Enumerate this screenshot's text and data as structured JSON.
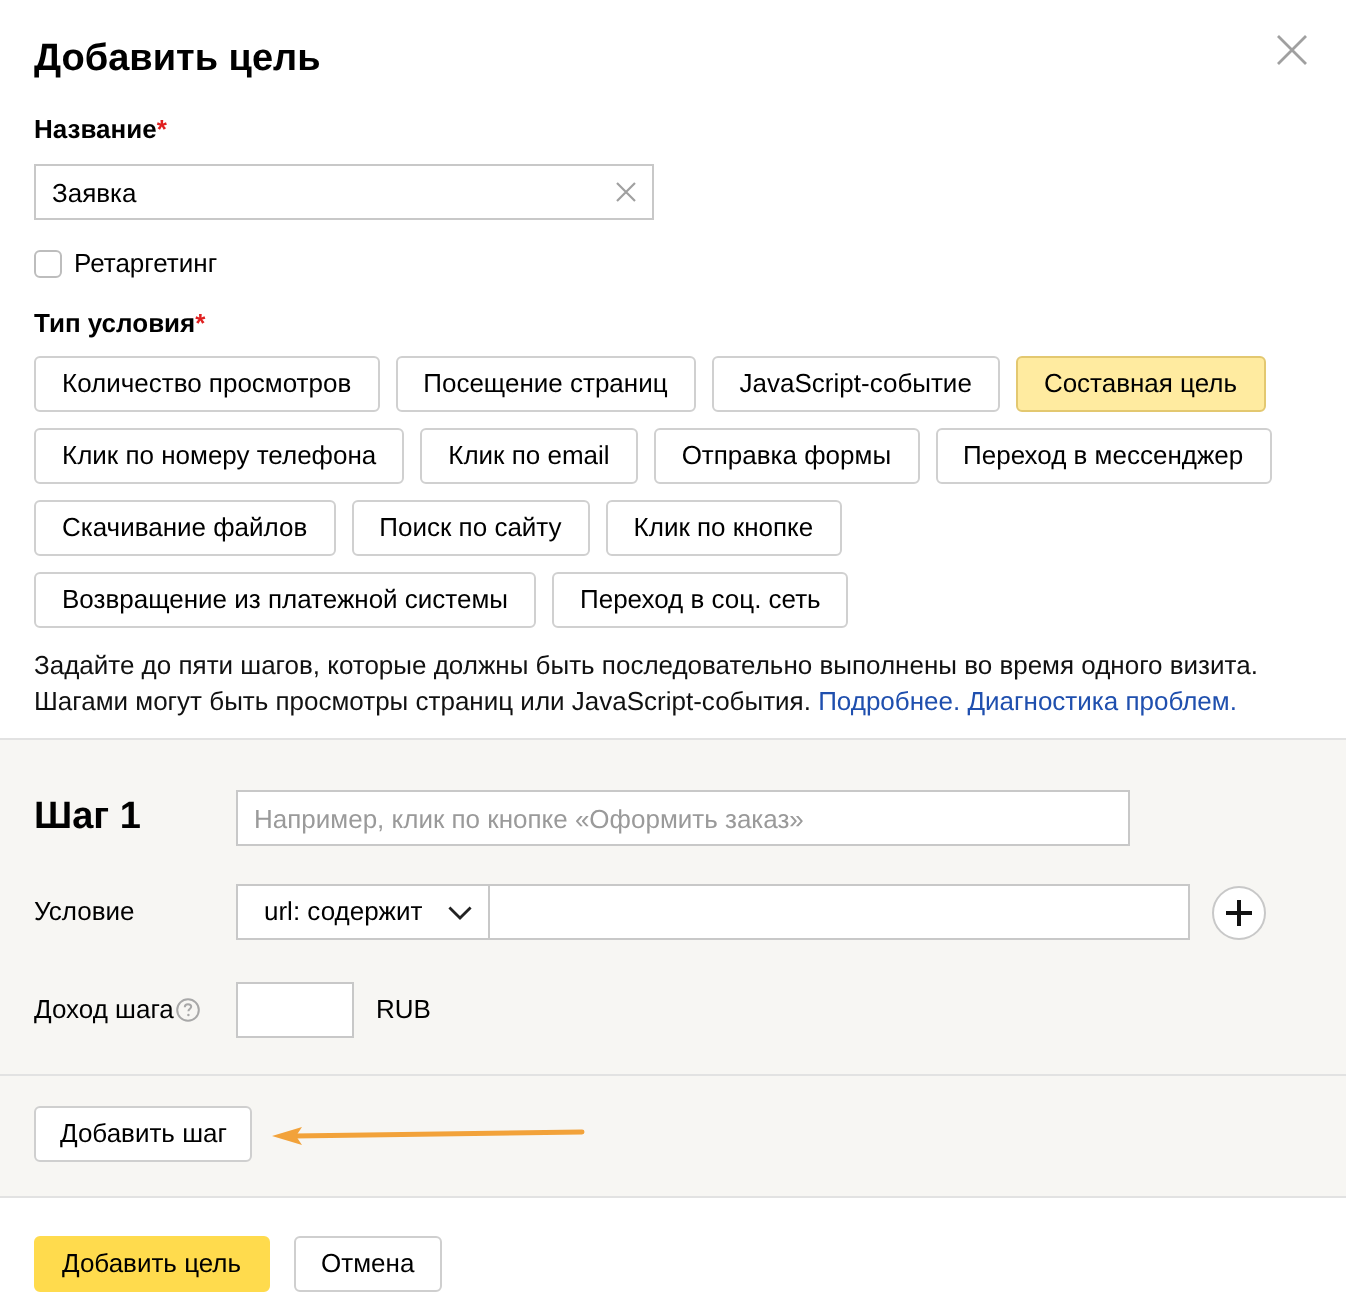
{
  "dialog": {
    "title": "Добавить цель"
  },
  "name_field": {
    "label": "Название",
    "required_mark": "*",
    "value": "Заявка"
  },
  "retargeting": {
    "label": "Ретаргетинг",
    "checked": false
  },
  "condition_type": {
    "label": "Тип условия",
    "required_mark": "*",
    "options": [
      {
        "label": "Количество просмотров",
        "selected": false
      },
      {
        "label": "Посещение страниц",
        "selected": false
      },
      {
        "label": "JavaScript-событие",
        "selected": false
      },
      {
        "label": "Составная цель",
        "selected": true
      },
      {
        "label": "Клик по номеру телефона",
        "selected": false
      },
      {
        "label": "Клик по email",
        "selected": false
      },
      {
        "label": "Отправка формы",
        "selected": false
      },
      {
        "label": "Переход в мессенджер",
        "selected": false
      },
      {
        "label": "Скачивание файлов",
        "selected": false
      },
      {
        "label": "Поиск по сайту",
        "selected": false
      },
      {
        "label": "Клик по кнопке",
        "selected": false
      },
      {
        "label": "Возвращение из платежной системы",
        "selected": false
      },
      {
        "label": "Переход в соц. сеть",
        "selected": false
      }
    ]
  },
  "description": {
    "text": "Задайте до пяти шагов, которые должны быть последовательно выполнены во время одного визита. Шагами могут быть просмотры страниц или JavaScript-события.",
    "links": [
      "Подробнее.",
      "Диагностика проблем."
    ]
  },
  "step": {
    "title": "Шаг 1",
    "name_field": {
      "placeholder": "Например, клик по кнопке «Оформить заказ»"
    },
    "condition_label": "Условие",
    "operator": "url: содержит",
    "revenue_label": "Доход шага",
    "currency": "RUB"
  },
  "add_step_button": "Добавить шаг",
  "footer_buttons": [
    {
      "label": "Добавить цель",
      "kind": "primary"
    },
    {
      "label": "Отмена",
      "kind": "secondary"
    }
  ]
}
